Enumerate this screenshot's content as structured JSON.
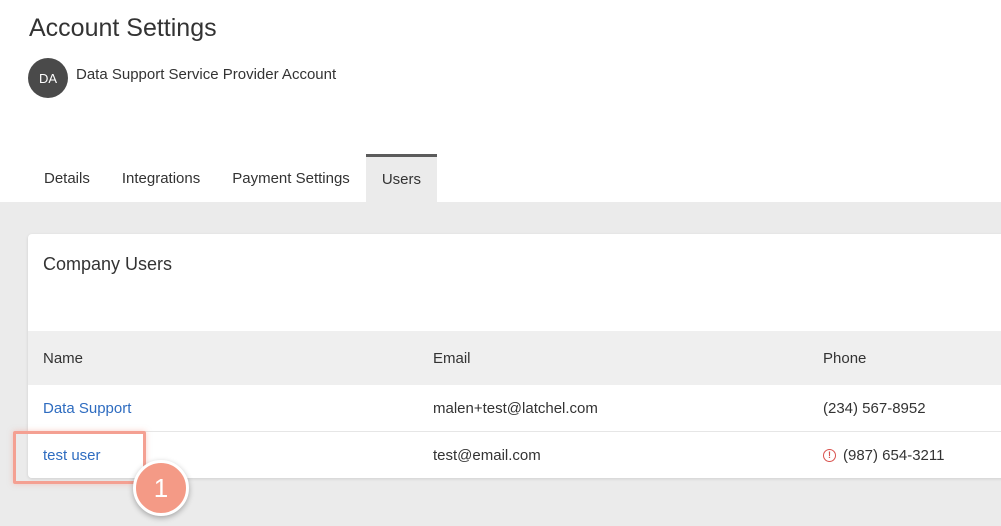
{
  "header": {
    "title": "Account Settings",
    "avatar_initials": "DA",
    "account_name": "Data Support Service Provider Account"
  },
  "tabs": [
    {
      "label": "Details",
      "active": false
    },
    {
      "label": "Integrations",
      "active": false
    },
    {
      "label": "Payment Settings",
      "active": false
    },
    {
      "label": "Users",
      "active": true
    }
  ],
  "card": {
    "title": "Company Users",
    "columns": [
      "Name",
      "Email",
      "Phone"
    ],
    "rows": [
      {
        "name": "Data Support",
        "email": "malen+test@latchel.com",
        "phone": "(234) 567-8952",
        "phone_warning": false
      },
      {
        "name": "test user",
        "email": "test@email.com",
        "phone": "(987) 654-3211",
        "phone_warning": true
      }
    ]
  },
  "annotation": {
    "step_number": "1",
    "highlight_color": "#f4a092"
  },
  "colors": {
    "link": "#2e6cc0",
    "warning": "#d9534f",
    "avatar_bg": "#4a4a4a"
  },
  "icons": {
    "warning": "alert-circle-icon"
  }
}
